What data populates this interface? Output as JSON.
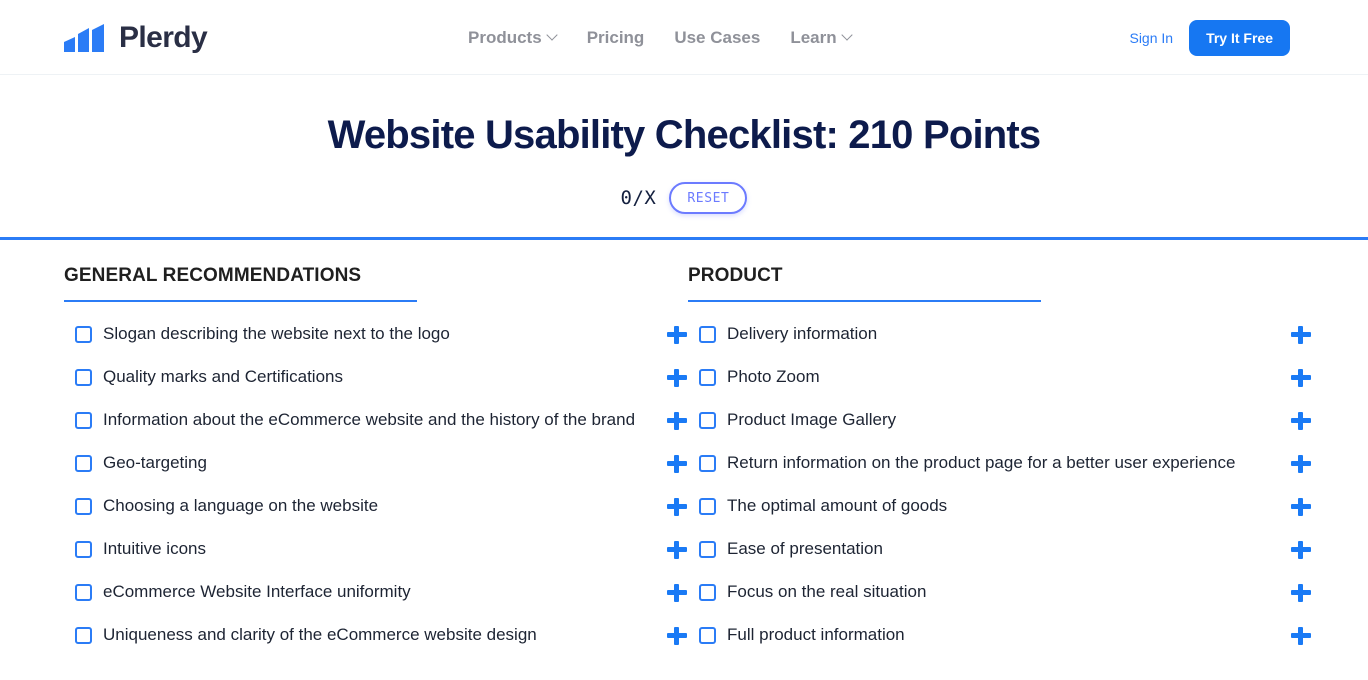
{
  "brand": {
    "name": "Plerdy",
    "logo_icon": "bar-chart-logo-icon"
  },
  "nav": {
    "links": [
      {
        "label": "Products",
        "has_caret": true
      },
      {
        "label": "Pricing",
        "has_caret": false
      },
      {
        "label": "Use Cases",
        "has_caret": false
      },
      {
        "label": "Learn",
        "has_caret": true
      }
    ],
    "sign_in": "Sign In",
    "cta": "Try It Free"
  },
  "hero": {
    "title": "Website Usability Checklist: 210 Points",
    "counter": "0/X",
    "reset_label": "RESET"
  },
  "colors": {
    "accent_blue": "#2b7cf6",
    "cta_blue": "#1677f2",
    "plus_blue": "#1a7af5",
    "title_navy": "#0d1b4c",
    "reset_purple": "#6c7bff",
    "nav_gray": "#8f9199"
  },
  "columns": [
    {
      "title": "GENERAL RECOMMENDATIONS",
      "items": [
        {
          "label": "Slogan describing the website next to the logo",
          "checked": false
        },
        {
          "label": "Quality marks and Certifications",
          "checked": false
        },
        {
          "label": "Information about the eCommerce website and the history of the brand",
          "checked": false
        },
        {
          "label": "Geo-targeting",
          "checked": false
        },
        {
          "label": "Choosing a language on the website",
          "checked": false
        },
        {
          "label": "Intuitive icons",
          "checked": false
        },
        {
          "label": "eCommerce Website Interface uniformity",
          "checked": false
        },
        {
          "label": "Uniqueness and clarity of the eCommerce website design",
          "checked": false
        }
      ]
    },
    {
      "title": "PRODUCT",
      "items": [
        {
          "label": "Delivery information",
          "checked": false
        },
        {
          "label": "Photo Zoom",
          "checked": false
        },
        {
          "label": "Product Image Gallery",
          "checked": false
        },
        {
          "label": "Return information on the product page for a better user experience",
          "checked": false
        },
        {
          "label": "The optimal amount of goods",
          "checked": false
        },
        {
          "label": "Ease of presentation",
          "checked": false
        },
        {
          "label": "Focus on the real situation",
          "checked": false
        },
        {
          "label": "Full product information",
          "checked": false
        }
      ]
    }
  ]
}
